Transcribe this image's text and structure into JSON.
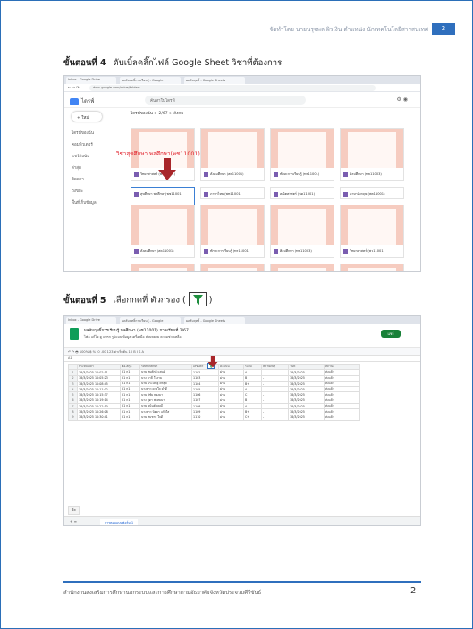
{
  "header": {
    "text": "จัดทำโดย นายนรุจพล ผิวเงิน ตำแหน่ง นักเทคโนโลยีสารสนเทศ",
    "page_tag": "2"
  },
  "step4": {
    "label": "ขั้นตอนที่ 4",
    "text": "ดับเบิ้ลคลิ๊กไฟล์ Google Sheet วิชาที่ต้องการ"
  },
  "step5": {
    "label": "ขั้นตอนที่ 5",
    "text_before": "เลือกกดที่ ตัวกรอง (",
    "text_after": ")"
  },
  "drive": {
    "tabs": [
      "Inbox - Google Drive",
      "ผลสัมฤทธิ์การเรียนรู้ - Google",
      "ผลสัมฤทธิ์ - Google Sheets"
    ],
    "url": "docs.google.com/drive/folders",
    "app_name": "ไดรฟ์",
    "search_placeholder": "ค้นหาในไดรฟ์",
    "new_button": "ใหม่",
    "side_items": [
      "ไดรฟ์ของฉัน",
      "คอมพิวเตอร์",
      "แชร์กับฉัน",
      "ล่าสุด",
      "ติดดาว",
      "ถังขยะ",
      "พื้นที่เก็บข้อมูล"
    ],
    "breadcrumb": "ไดรฟ์ของฉัน > 2/67 > สังคม",
    "red_label": "วิชาสุขศึกษา พลศึกษา(พช11001)",
    "cards": [
      "สุขศึกษา พลศึกษา(พช11001)",
      "ภาษาไทย (พท11001)",
      "คณิตศาสตร์ (พค11001)",
      "ภาษาอังกฤษ (พต11001)",
      "วิทยาศาสตร์ (พว11001)",
      "สังคมศึกษา (สค11001)",
      "ทักษะการเรียนรู้ (ทร11001)",
      "ศิลปศึกษา (ทช11003)"
    ]
  },
  "sheet": {
    "title": "ผลสัมฤทธิ์การเรียนรู้ พลศึกษา (พช11001) ภาคเรียนที่ 2/67",
    "menu": "ไฟล์  แก้ไข  ดู  แทรก  รูปแบบ  ข้อมูล  เครื่องมือ  ส่วนขยาย  ความช่วยเหลือ",
    "share": "แชร์",
    "toolbar": "↶  ↷  🖶  100%  ฿  %  .0  .00  123  ค่าเริ่มต้น  10  B  I  S  A",
    "cell_ref": "A1",
    "headers": [
      "",
      "ประทับเวลา",
      "ชื่อ-สกุล",
      "รหัสนักศึกษา",
      "เลขบัตร",
      "คะแนน",
      "ระดับ",
      "หมายเหตุ",
      "วันที่",
      "สถานะ"
    ],
    "rows": [
      [
        "1",
        "18/3/2025 10:02:11",
        "51 ก1",
        "นาย สมศักดิ์ แสนดี",
        "1102",
        "ผ่าน",
        "A",
        "-",
        "18/3/2025",
        "ส่งแล้ว"
      ],
      [
        "2",
        "18/3/2025 10:05:23",
        "51 ก1",
        "นาง มาลี ใจงาม",
        "1103",
        "ผ่าน",
        "B",
        "-",
        "18/3/2025",
        "ส่งแล้ว"
      ],
      [
        "3",
        "18/3/2025 10:08:45",
        "51 ก1",
        "นาย ประเสริฐ ศรีสุข",
        "1104",
        "ผ่าน",
        "B+",
        "-",
        "18/3/2025",
        "ส่งแล้ว"
      ],
      [
        "4",
        "18/3/2025 10:11:02",
        "51 ก1",
        "นางสาว ดวงใจ คำดี",
        "1105",
        "ผ่าน",
        "A",
        "-",
        "18/3/2025",
        "ส่งแล้ว"
      ],
      [
        "5",
        "18/3/2025 10:15:37",
        "51 ก1",
        "นาย วิชัย ทองมา",
        "1106",
        "ผ่าน",
        "C",
        "-",
        "18/3/2025",
        "ส่งแล้ว"
      ],
      [
        "6",
        "18/3/2025 10:19:14",
        "51 ก1",
        "นาง สุดา พรหมมา",
        "1107",
        "ผ่าน",
        "B",
        "-",
        "18/3/2025",
        "ส่งแล้ว"
      ],
      [
        "7",
        "18/3/2025 10:22:50",
        "51 ก1",
        "นาย อนันต์ บุญมี",
        "1108",
        "ผ่าน",
        "A",
        "-",
        "18/3/2025",
        "ส่งแล้ว"
      ],
      [
        "8",
        "18/3/2025 10:26:08",
        "51 ก1",
        "นางสาว นิตยา แก้วใส",
        "1109",
        "ผ่าน",
        "B+",
        "-",
        "18/3/2025",
        "ส่งแล้ว"
      ],
      [
        "9",
        "18/3/2025 10:30:41",
        "51 ก1",
        "นาย สมชาย ใจดี",
        "1110",
        "ผ่าน",
        "C+",
        "-",
        "18/3/2025",
        "ส่งแล้ว"
      ]
    ],
    "tab_label": "การตอบแบบฟอร์ม 1",
    "sheets_label": "ชีต"
  },
  "footer": {
    "text": "สำนักงานส่งเสริมการศึกษานอกระบบและการศึกษาตามอัธยาศัยจังหวัดประจวบคีรีขันธ์",
    "page_number": "2"
  },
  "colors": {
    "accent": "#2f6fbd",
    "arrow": "#a8262a",
    "red_text": "#e0202a",
    "sheets_green": "#0f9d58"
  }
}
